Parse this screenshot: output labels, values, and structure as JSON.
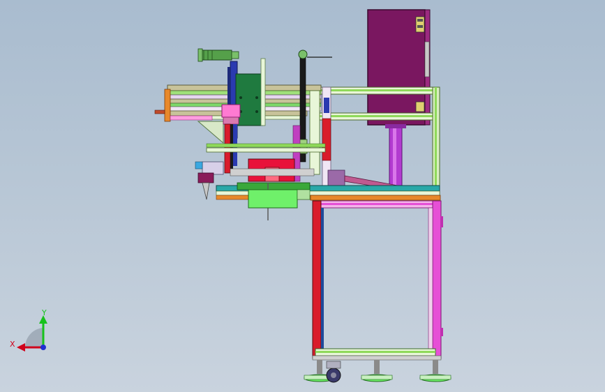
{
  "viewport": {
    "background_top": "#a9bccf",
    "background_bottom": "#c9d3de"
  },
  "triad": {
    "x_label": "X",
    "y_label": "Y",
    "x_color": "#d0021b",
    "y_color": "#17c21c",
    "z_color": "#1f2fd0"
  },
  "model": {
    "name": "",
    "palette": {
      "frame_magenta": "#e64fd6",
      "frame_red": "#d91c2b",
      "frame_green": "#8fd95a",
      "cabinet_purple": "#7a1760",
      "pillar_violet": "#b23bd0",
      "pcb_green": "#1f7a3f",
      "plate_lime": "#6ff06a",
      "top_rail_tan": "#c8c39a",
      "navy": "#1d2a7a",
      "orange": "#e8892a",
      "teal": "#2aa8a8",
      "foot_gray": "#b0b0b0"
    }
  }
}
